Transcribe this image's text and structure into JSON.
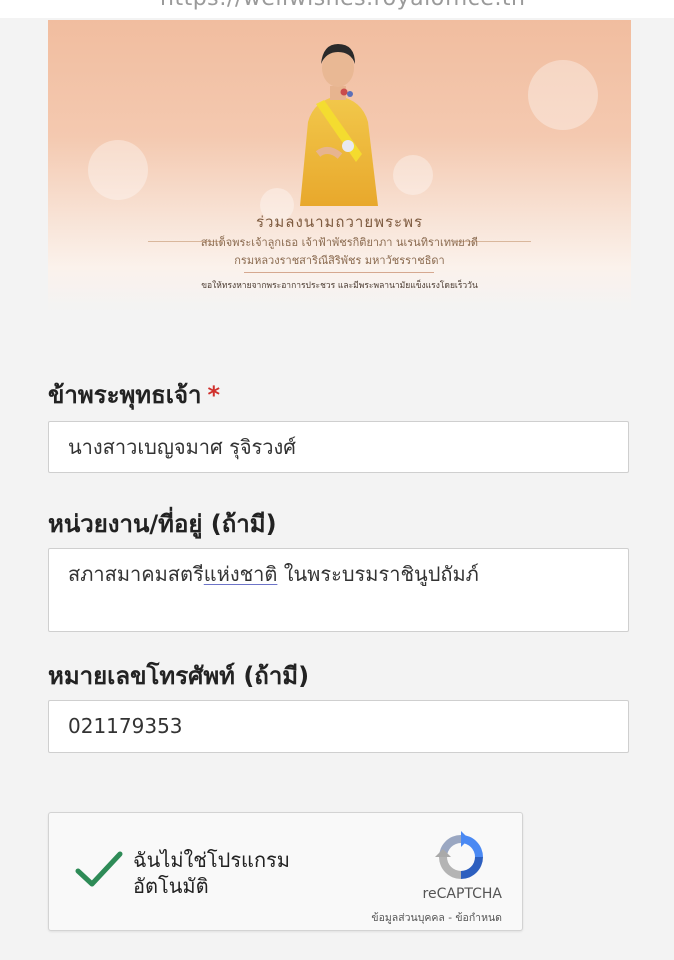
{
  "browser": {
    "url": "https://wellwishes.royaloffice.th"
  },
  "banner": {
    "title": "ร่วมลงนามถวายพระพร",
    "subtitle_line1": "สมเด็จพระเจ้าลูกเธอ เจ้าฟ้าพัชรกิติยาภา นเรนทิราเทพยวดี",
    "subtitle_line2": "กรมหลวงราชสาริณีสิริพัชร มหาวัชรราชธิดา",
    "wish_text": "ขอให้ทรงหายจากพระอาการประชวร และมีพระพลานามัยแข็งแรงโดยเร็ววัน"
  },
  "form": {
    "name": {
      "label": "ข้าพระพุทธเจ้า",
      "required_mark": "*",
      "value": "นางสาวเบญจมาศ รุจิรวงศ์"
    },
    "org": {
      "label": "หน่วยงาน/ที่อยู่ (ถ้ามี)",
      "value_part1": "สภาสมาคมสตรี",
      "value_part2": "แห่งชาติ",
      "value_part3": " ในพระบรมราชินูปถัมภ์"
    },
    "phone": {
      "label": "หมายเลขโทรศัพท์ (ถ้ามี)",
      "value": "021179353"
    }
  },
  "recaptcha": {
    "line1": "ฉันไม่ใช่โปรแกรม",
    "line2": "อัตโนมัติ",
    "brand": "reCAPTCHA",
    "privacy": "ข้อมูลส่วนบุคคล",
    "separator": " - ",
    "terms": "ข้อกำหนด",
    "checked": true,
    "check_color": "#2e8b57"
  }
}
